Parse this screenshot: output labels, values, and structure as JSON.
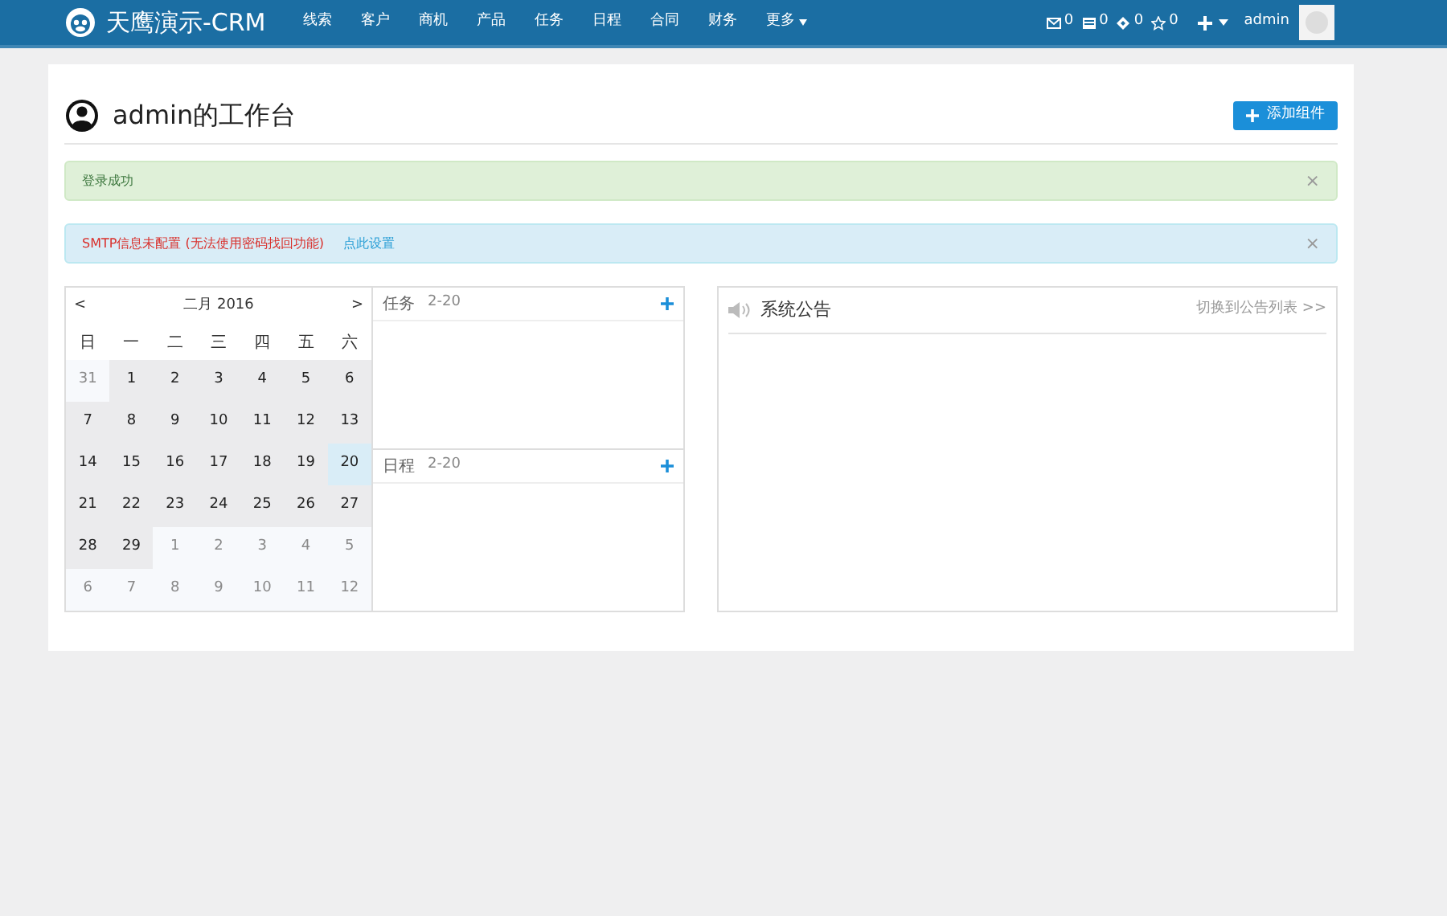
{
  "navbar": {
    "brand": "天鹰演示-CRM",
    "menu": [
      {
        "label": "线索",
        "dropdown": false
      },
      {
        "label": "客户",
        "dropdown": false
      },
      {
        "label": "商机",
        "dropdown": false
      },
      {
        "label": "产品",
        "dropdown": false
      },
      {
        "label": "任务",
        "dropdown": false
      },
      {
        "label": "日程",
        "dropdown": false
      },
      {
        "label": "合同",
        "dropdown": false
      },
      {
        "label": "财务",
        "dropdown": false
      },
      {
        "label": "更多",
        "dropdown": true
      }
    ],
    "counters": [
      {
        "kind": "mail",
        "count": "0"
      },
      {
        "kind": "message",
        "count": "0"
      },
      {
        "kind": "task",
        "count": "0"
      },
      {
        "kind": "star",
        "count": "0"
      }
    ],
    "user": "admin"
  },
  "page": {
    "title": "admin的工作台",
    "add_button": "添加组件"
  },
  "alerts": [
    {
      "kind": "success",
      "message": "登录成功",
      "close": "×"
    },
    {
      "kind": "info",
      "message": "SMTP信息未配置 (无法使用密码找回功能)",
      "link": "点此设置",
      "close": "×"
    }
  ],
  "calendar": {
    "prev": "<",
    "next": ">",
    "month": "二月 2016",
    "weekdays": [
      "日",
      "一",
      "二",
      "三",
      "四",
      "五",
      "六"
    ],
    "weeks": [
      [
        {
          "day": "31",
          "other_month": true,
          "selected": false
        },
        {
          "day": "1",
          "other_month": false,
          "selected": false
        },
        {
          "day": "2",
          "other_month": false,
          "selected": false
        },
        {
          "day": "3",
          "other_month": false,
          "selected": false
        },
        {
          "day": "4",
          "other_month": false,
          "selected": false
        },
        {
          "day": "5",
          "other_month": false,
          "selected": false
        },
        {
          "day": "6",
          "other_month": false,
          "selected": false
        }
      ],
      [
        {
          "day": "7",
          "other_month": false,
          "selected": false
        },
        {
          "day": "8",
          "other_month": false,
          "selected": false
        },
        {
          "day": "9",
          "other_month": false,
          "selected": false
        },
        {
          "day": "10",
          "other_month": false,
          "selected": false
        },
        {
          "day": "11",
          "other_month": false,
          "selected": false
        },
        {
          "day": "12",
          "other_month": false,
          "selected": false
        },
        {
          "day": "13",
          "other_month": false,
          "selected": false
        }
      ],
      [
        {
          "day": "14",
          "other_month": false,
          "selected": false
        },
        {
          "day": "15",
          "other_month": false,
          "selected": false
        },
        {
          "day": "16",
          "other_month": false,
          "selected": false
        },
        {
          "day": "17",
          "other_month": false,
          "selected": false
        },
        {
          "day": "18",
          "other_month": false,
          "selected": false
        },
        {
          "day": "19",
          "other_month": false,
          "selected": false
        },
        {
          "day": "20",
          "other_month": false,
          "selected": true
        }
      ],
      [
        {
          "day": "21",
          "other_month": false,
          "selected": false
        },
        {
          "day": "22",
          "other_month": false,
          "selected": false
        },
        {
          "day": "23",
          "other_month": false,
          "selected": false
        },
        {
          "day": "24",
          "other_month": false,
          "selected": false
        },
        {
          "day": "25",
          "other_month": false,
          "selected": false
        },
        {
          "day": "26",
          "other_month": false,
          "selected": false
        },
        {
          "day": "27",
          "other_month": false,
          "selected": false
        }
      ],
      [
        {
          "day": "28",
          "other_month": false,
          "selected": false
        },
        {
          "day": "29",
          "other_month": false,
          "selected": false
        },
        {
          "day": "1",
          "other_month": true,
          "selected": false
        },
        {
          "day": "2",
          "other_month": true,
          "selected": false
        },
        {
          "day": "3",
          "other_month": true,
          "selected": false
        },
        {
          "day": "4",
          "other_month": true,
          "selected": false
        },
        {
          "day": "5",
          "other_month": true,
          "selected": false
        }
      ],
      [
        {
          "day": "6",
          "other_month": true,
          "selected": false
        },
        {
          "day": "7",
          "other_month": true,
          "selected": false
        },
        {
          "day": "8",
          "other_month": true,
          "selected": false
        },
        {
          "day": "9",
          "other_month": true,
          "selected": false
        },
        {
          "day": "10",
          "other_month": true,
          "selected": false
        },
        {
          "day": "11",
          "other_month": true,
          "selected": false
        },
        {
          "day": "12",
          "other_month": true,
          "selected": false
        }
      ]
    ]
  },
  "day_panels": [
    {
      "title": "任务",
      "date": "2-20"
    },
    {
      "title": "日程",
      "date": "2-20"
    }
  ],
  "announcements": {
    "title": "系统公告",
    "link": "切换到公告列表 >>"
  }
}
